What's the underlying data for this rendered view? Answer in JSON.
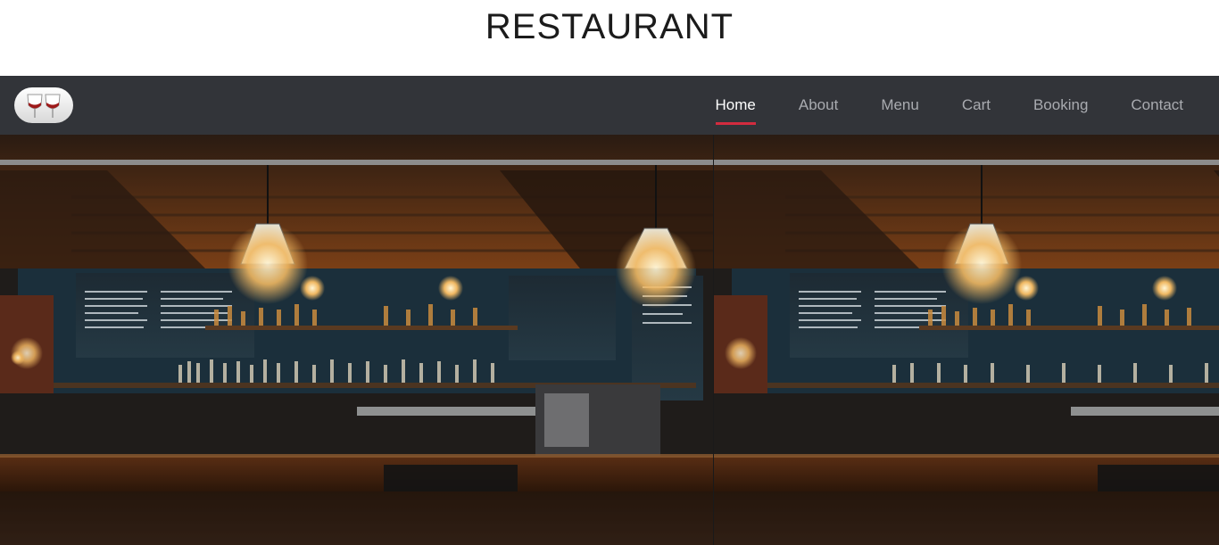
{
  "site": {
    "title": "RESTAURANT"
  },
  "logo": {
    "icon": "wine-glasses-icon"
  },
  "nav": {
    "items": [
      {
        "label": "Home",
        "active": true
      },
      {
        "label": "About",
        "active": false
      },
      {
        "label": "Menu",
        "active": false
      },
      {
        "label": "Cart",
        "active": false
      },
      {
        "label": "Booking",
        "active": false
      },
      {
        "label": "Contact",
        "active": false
      }
    ]
  },
  "hero": {
    "image": "bar-interior-photo",
    "tiles": 2
  },
  "colors": {
    "navbar": "#323439",
    "accent": "#d22b3f",
    "nav_text": "#a9abb0",
    "nav_active": "#ffffff"
  }
}
